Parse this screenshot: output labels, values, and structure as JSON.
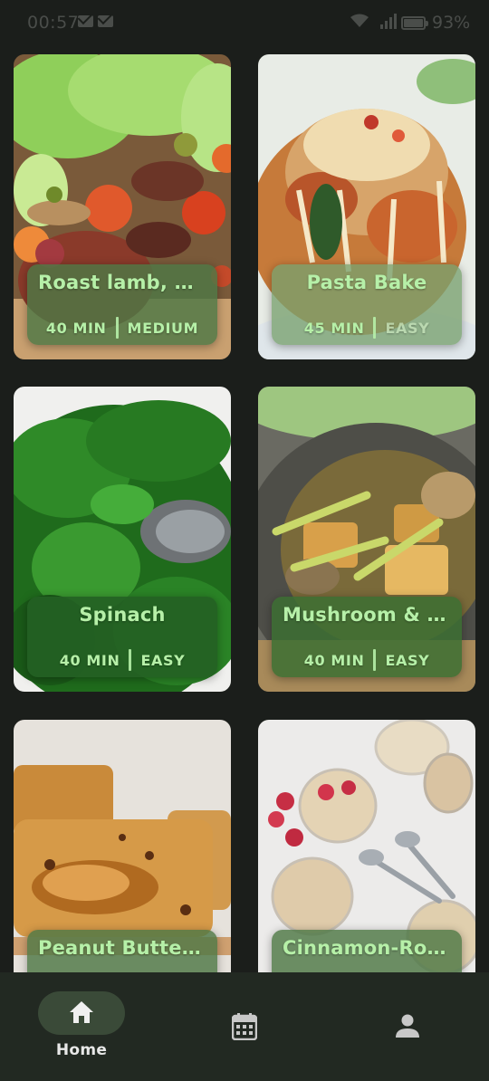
{
  "status_bar": {
    "time": "00:57",
    "battery": "93%",
    "network": "4G"
  },
  "recipes": [
    {
      "title": "Roast lamb, b...",
      "time": "40 MIN",
      "difficulty": "MEDIUM",
      "image": "roast-lamb-salad-photo"
    },
    {
      "title": "Pasta Bake",
      "time": "45 MIN",
      "difficulty": "EASY",
      "image": "pasta-bake-photo"
    },
    {
      "title": "Spinach",
      "time": "40 MIN",
      "difficulty": "EASY",
      "image": "spinach-photo"
    },
    {
      "title": "Mushroom & T...",
      "time": "40 MIN",
      "difficulty": "EASY",
      "image": "mushroom-tofu-photo"
    },
    {
      "title": "Peanut Butter...",
      "time": "",
      "difficulty": "",
      "image": "peanut-butter-bar-photo"
    },
    {
      "title": "Cinnamon-Rol...",
      "time": "",
      "difficulty": "",
      "image": "cinnamon-oats-photo"
    }
  ],
  "bottom_nav": {
    "home_label": "Home",
    "home_icon": "home-icon",
    "calendar_icon": "calendar-icon",
    "profile_icon": "person-icon"
  },
  "colors": {
    "background": "#1b1e1b",
    "accent_text": "#b6f0a8",
    "nav_background": "#222922",
    "nav_pill": "#3a4a38"
  }
}
